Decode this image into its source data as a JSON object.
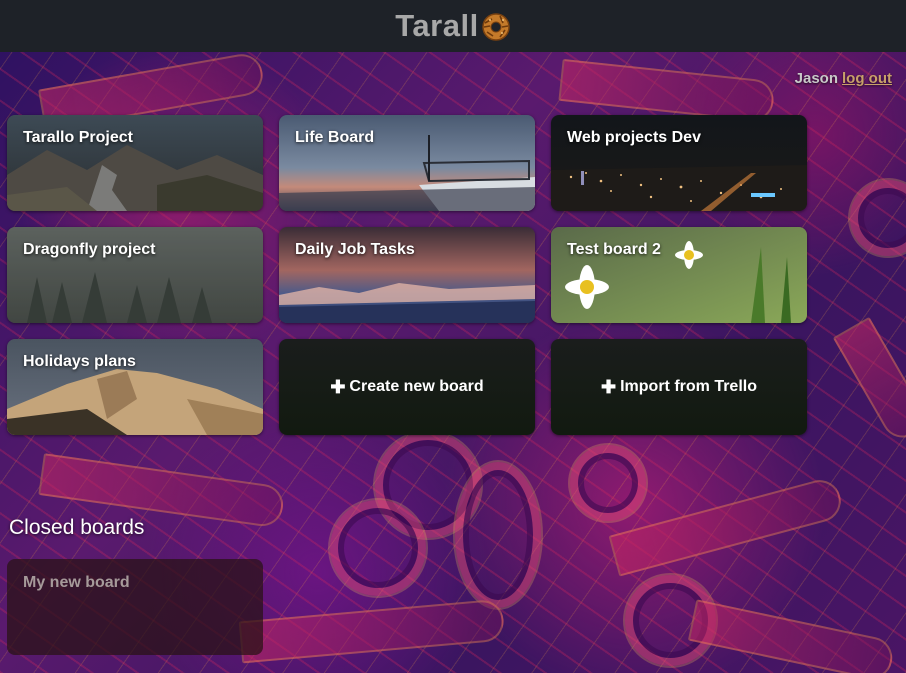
{
  "app": {
    "title": "Tarall",
    "logo_icon": "taralli-logo-icon"
  },
  "user": {
    "name": "Jason",
    "logout_label": "log out"
  },
  "boards": [
    {
      "label": "Tarallo Project"
    },
    {
      "label": "Life Board"
    },
    {
      "label": "Web projects Dev"
    },
    {
      "label": "Dragonfly project"
    },
    {
      "label": "Daily Job Tasks"
    },
    {
      "label": "Test board 2"
    },
    {
      "label": "Holidays plans"
    }
  ],
  "actions": {
    "create_label": "Create new board",
    "import_label": "Import from Trello",
    "plus_glyph": "✚"
  },
  "closed": {
    "heading": "Closed boards",
    "boards": [
      {
        "label": "My new board"
      }
    ]
  },
  "colors": {
    "topbar": "#1e2228",
    "brand_text": "#a8a8a8",
    "logout_link": "#c8a06a",
    "action_tile": "#151b12"
  }
}
